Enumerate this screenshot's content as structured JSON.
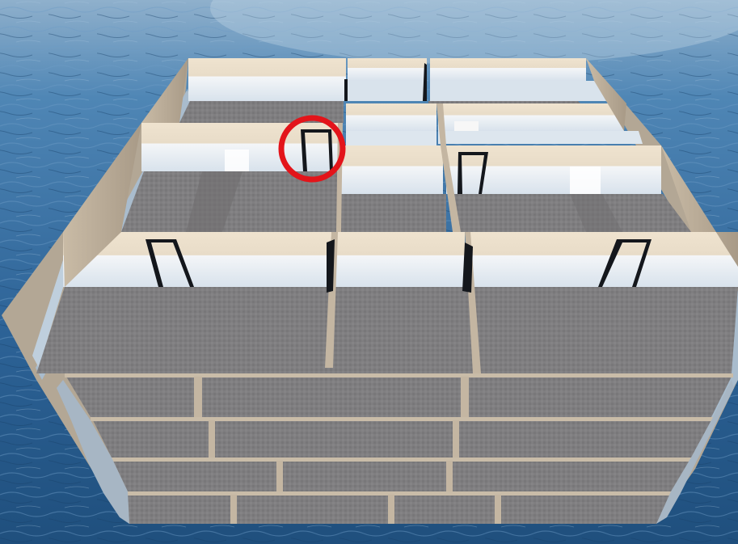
{
  "scene": {
    "subject": "cutaway-multistory-building-over-water",
    "floors_below_roof": 4,
    "doors_visible": 8,
    "highlighted_element": "doorway-marker"
  },
  "colors": {
    "water_dark": "#1f4f7d",
    "water_light": "#4f86b5",
    "sky_haze": "#9fb9d1",
    "floor": "#7d7c7d",
    "floor_dark": "#6f6e70",
    "wall_top": "#ecdfca",
    "wall_lower": "#dfe6ee",
    "wall_side": "#b9ab98",
    "outer_wall": "#a7b6c4",
    "door": "#14171c",
    "highlight_ring": "#e3141a"
  }
}
